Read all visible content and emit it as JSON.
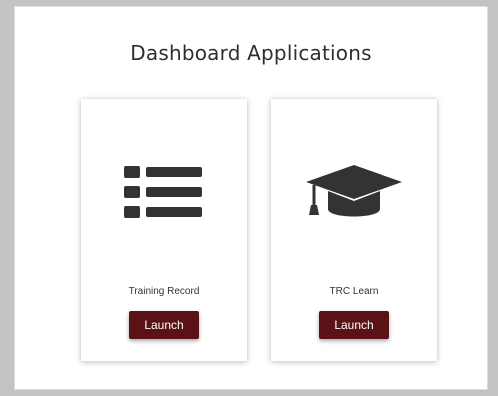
{
  "page": {
    "title": "Dashboard Applications"
  },
  "apps": [
    {
      "label": "Training Record",
      "button_label": "Launch",
      "icon": "list-icon"
    },
    {
      "label": "TRC Learn",
      "button_label": "Launch",
      "icon": "graduation-cap-icon"
    }
  ],
  "colors": {
    "page_background": "#c3c3c3",
    "panel_background": "#ffffff",
    "button_background": "#5a1216",
    "icon_color": "#333333"
  }
}
